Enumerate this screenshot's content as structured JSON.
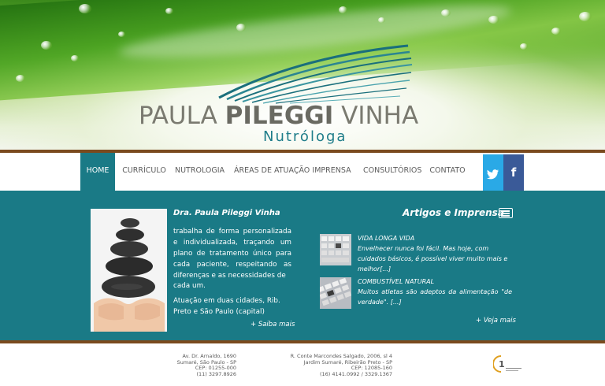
{
  "brand": {
    "name_light_1": "PAULA ",
    "name_bold": "PILEGGI",
    "name_light_2": " VINHA",
    "subtitle": "Nutróloga"
  },
  "nav": {
    "items": [
      {
        "label": "HOME",
        "active": true
      },
      {
        "label": "CURRÍCULO",
        "active": false
      },
      {
        "label": "NUTROLOGIA",
        "active": false
      },
      {
        "label": "ÁREAS DE ATUAÇÃO",
        "active": false
      },
      {
        "label": "IMPRENSA",
        "active": false
      },
      {
        "label": "CONSULTÓRIOS",
        "active": false
      },
      {
        "label": "CONTATO",
        "active": false
      }
    ],
    "social": {
      "twitter": "twitter-icon",
      "facebook": "facebook-icon"
    }
  },
  "about": {
    "title": "Dra. Paula Pileggi Vinha",
    "paragraph_1": "trabalha de forma personalizada e individualizada, traçando um plano de tratamento único para cada paciente, respeitando as diferenças e as necessidades de",
    "paragraph_1_end": "cada um.",
    "paragraph_2": "Atuação em duas cidades, Rib. Preto e São Paulo (capital)",
    "more_link": "+ Saiba mais"
  },
  "articles": {
    "title": "Artigos e Imprensa",
    "items": [
      {
        "headline": "VIDA LONGA VIDA",
        "summary": "Envelhecer nunca foi fácil. Mas hoje, com cuidados básicos, é possível viver muito mais e melhor[...]"
      },
      {
        "headline": "COMBUSTÍVEL NATURAL",
        "summary": "Muitos atletas são adeptos da alimentação \"de verdade\". [...]"
      }
    ],
    "more_link": "+ Veja mais"
  },
  "footer": {
    "address_1": [
      "Av. Dr. Arnaldo, 1690",
      "Sumaré, São Paulo - SP",
      "CEP: 01255-000",
      "(11) 3297.8926"
    ],
    "address_2": [
      "R. Conte Marcondes Salgado, 2006, sl 4",
      "Jardim Sumaré, Ribeirão Preto - SP",
      "CEP: 12085-160",
      "(16) 4141.0992 / 3329.1367"
    ],
    "credit_logo": "1"
  },
  "colors": {
    "teal": "#1a7a86",
    "brown": "#7a4a1e",
    "twitter": "#2aa9e6",
    "facebook": "#3a5a98"
  }
}
